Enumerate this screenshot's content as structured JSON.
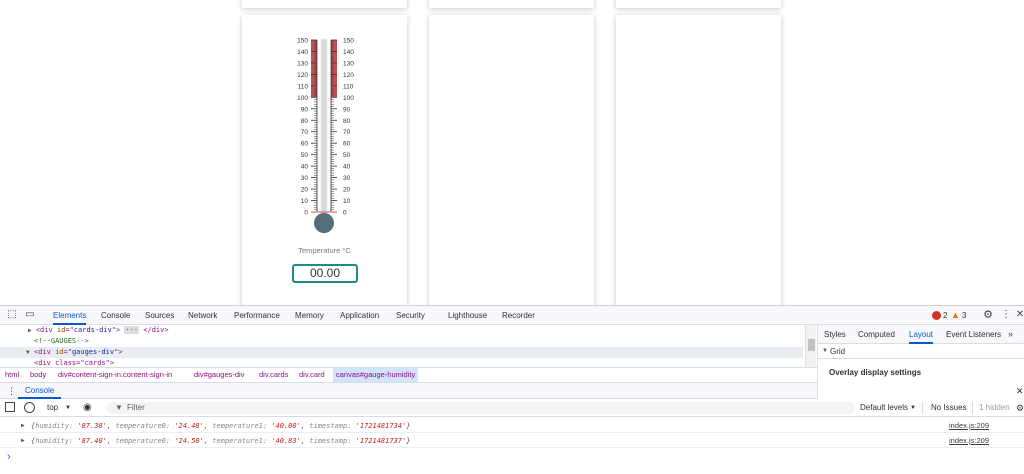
{
  "gauge": {
    "min": 0,
    "max": 150,
    "major_ticks": [
      "150",
      "140",
      "130",
      "120",
      "110",
      "100",
      "90",
      "80",
      "70",
      "60",
      "50",
      "40",
      "30",
      "20",
      "10",
      "0"
    ],
    "highlight_from": 100,
    "highlight_to": 150,
    "highlight_color": "#c0504d",
    "bulb_color": "#546e7a",
    "value": 0,
    "label": "Temperature °C",
    "readout": "00.00",
    "readout_border_color": "#1f8a8a"
  },
  "devtools": {
    "tabs": [
      "Elements",
      "Console",
      "Sources",
      "Network",
      "Performance",
      "Memory",
      "Application",
      "Security",
      "Lighthouse",
      "Recorder"
    ],
    "active_tab": "Elements",
    "errors": "2",
    "warnings": "3",
    "elements": {
      "line1": {
        "open": "<div ",
        "attr": "id",
        "eq": "=\"",
        "val": "cards-div",
        "close": "\">",
        "ellipsis": "···",
        "end": "</div>"
      },
      "line2": "<!--GAUGES-->",
      "line3": {
        "open": "<div ",
        "attr": "id",
        "eq": "=\"",
        "val": "gauges-div",
        "close": "\">"
      },
      "line4": "<div class=\"cards\">"
    },
    "side_tabs": [
      "Styles",
      "Computed",
      "Layout",
      "Event Listeners"
    ],
    "active_side_tab": "Layout",
    "grid_section": "Grid",
    "overlay_settings": "Overlay display settings",
    "breadcrumbs": [
      "html",
      "body",
      "div#content-sign-in.content-sign-in",
      "div#gauges-div",
      "div.cards",
      "div.card",
      "canvas#gauge-humidity"
    ],
    "drawer_tab": "Console",
    "console": {
      "context": "top",
      "filter_placeholder": "Filter",
      "levels": "Default levels",
      "no_issues": "No Issues",
      "hidden": "1 hidden",
      "logs": [
        {
          "humidity": "'87.38'",
          "temperature0": "'24.48'",
          "temperature1": "'40.00'",
          "timestamp": "'1721481734'",
          "source": "index.js:209"
        },
        {
          "humidity": "'87.40'",
          "temperature0": "'24.50'",
          "temperature1": "'40.83'",
          "timestamp": "'1721481737'",
          "source": "index.js:209"
        }
      ],
      "prompt": "›"
    }
  }
}
